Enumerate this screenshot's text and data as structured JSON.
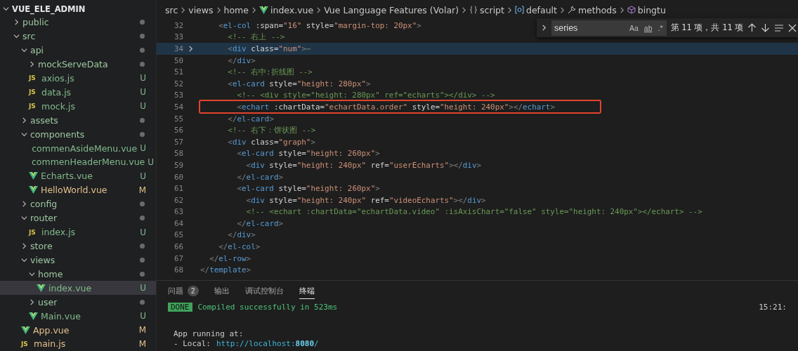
{
  "explorer": {
    "title": "VUE_ELE_ADMIN",
    "expanded": true,
    "items": [
      {
        "name": "public",
        "kind": "folder",
        "expanded": false,
        "dot": true,
        "selected": false
      },
      {
        "name": "src",
        "kind": "folder",
        "expanded": true,
        "dot": true,
        "selected": false,
        "children": [
          {
            "name": "api",
            "kind": "folder",
            "expanded": true,
            "dot": true,
            "selected": false,
            "children": [
              {
                "name": "mockServeData",
                "kind": "folder",
                "expanded": false,
                "dot": true,
                "selected": false
              },
              {
                "name": "axios.js",
                "kind": "js",
                "icon_label": "JS",
                "status": "U",
                "selected": false
              },
              {
                "name": "data.js",
                "kind": "js",
                "icon_label": "JS",
                "status": "U",
                "selected": false
              },
              {
                "name": "mock.js",
                "kind": "js",
                "icon_label": "JS",
                "status": "U",
                "selected": false
              }
            ]
          },
          {
            "name": "assets",
            "kind": "folder",
            "expanded": false,
            "dot": true,
            "selected": false
          },
          {
            "name": "components",
            "kind": "folder",
            "expanded": true,
            "dot": true,
            "selected": false,
            "children": [
              {
                "name": "commenAsideMenu.vue",
                "kind": "vue",
                "status": "U",
                "selected": false
              },
              {
                "name": "commenHeaderMenu.vue",
                "kind": "vue",
                "status": "U",
                "selected": false
              },
              {
                "name": "Echarts.vue",
                "kind": "vue",
                "status": "U",
                "selected": false
              },
              {
                "name": "HelloWorld.vue",
                "kind": "vue",
                "status": "M",
                "selected": false
              }
            ]
          },
          {
            "name": "config",
            "kind": "folder",
            "expanded": false,
            "dot": true,
            "selected": false
          },
          {
            "name": "router",
            "kind": "folder",
            "expanded": true,
            "dot": true,
            "selected": false,
            "children": [
              {
                "name": "index.js",
                "kind": "js",
                "icon_label": "JS",
                "status": "U",
                "selected": false
              }
            ]
          },
          {
            "name": "store",
            "kind": "folder",
            "expanded": false,
            "dot": true,
            "selected": false
          },
          {
            "name": "views",
            "kind": "folder",
            "expanded": true,
            "dot": true,
            "selected": false,
            "children": [
              {
                "name": "home",
                "kind": "folder",
                "expanded": true,
                "dot": true,
                "selected": false,
                "children": [
                  {
                    "name": "index.vue",
                    "kind": "vue",
                    "status": "U",
                    "selected": true
                  }
                ]
              },
              {
                "name": "user",
                "kind": "folder",
                "expanded": false,
                "dot": true,
                "selected": false
              },
              {
                "name": "Main.vue",
                "kind": "vue",
                "status": "U",
                "selected": false
              }
            ]
          },
          {
            "name": "App.vue",
            "kind": "vue",
            "status": "M",
            "selected": false
          },
          {
            "name": "main.js",
            "kind": "js",
            "icon_label": "JS",
            "status": "M",
            "selected": false
          }
        ]
      }
    ]
  },
  "breadcrumbs": [
    {
      "label": "src",
      "kind": "path"
    },
    {
      "label": "views",
      "kind": "path"
    },
    {
      "label": "home",
      "kind": "path"
    },
    {
      "label": "index.vue",
      "kind": "file"
    },
    {
      "label": "Vue Language Features (Volar)",
      "kind": "extension"
    },
    {
      "label": "script",
      "kind": "section"
    },
    {
      "label": "default",
      "kind": "variable"
    },
    {
      "label": "methods",
      "kind": "method"
    },
    {
      "label": "bingtu",
      "kind": "function"
    }
  ],
  "find": {
    "value": "series",
    "options": [
      "Aa",
      "ab",
      ".*"
    ],
    "result": "第 11 项，共 11 项"
  },
  "code": [
    {
      "number": "32",
      "current": false,
      "boxed": false,
      "folded": false,
      "text": "    <el-col :span=\"16\" style=\"margin-top: 20px\">"
    },
    {
      "number": "33",
      "current": false,
      "boxed": false,
      "folded": false,
      "text": "      <!-- 右上 -->"
    },
    {
      "number": "34",
      "current": true,
      "boxed": false,
      "folded": true,
      "text": "      <div class=\"num\">⋯"
    },
    {
      "number": "50",
      "current": false,
      "boxed": false,
      "folded": false,
      "text": "      </div>"
    },
    {
      "number": "51",
      "current": false,
      "boxed": false,
      "folded": false,
      "text": "      <!-- 右中:折线图 -->"
    },
    {
      "number": "52",
      "current": false,
      "boxed": false,
      "folded": false,
      "text": "      <el-card style=\"height: 280px\">"
    },
    {
      "number": "53",
      "current": false,
      "boxed": false,
      "folded": false,
      "text": "        <!-- <div style=\"height: 280px\" ref=\"echarts\"></div> -->"
    },
    {
      "number": "54",
      "current": false,
      "boxed": true,
      "folded": false,
      "text": "        <echart :chartData=\"echartData.order\" style=\"height: 240px\"></echart>"
    },
    {
      "number": "55",
      "current": false,
      "boxed": false,
      "folded": false,
      "text": "      </el-card>"
    },
    {
      "number": "56",
      "current": false,
      "boxed": false,
      "folded": false,
      "text": "      <!-- 右下：饼状图 -->"
    },
    {
      "number": "57",
      "current": false,
      "boxed": false,
      "folded": false,
      "text": "      <div class=\"graph\">"
    },
    {
      "number": "58",
      "current": false,
      "boxed": false,
      "folded": false,
      "text": "        <el-card style=\"height: 260px\">"
    },
    {
      "number": "59",
      "current": false,
      "boxed": false,
      "folded": false,
      "text": "          <div style=\"height: 240px\" ref=\"userEcharts\"></div>"
    },
    {
      "number": "60",
      "current": false,
      "boxed": false,
      "folded": false,
      "text": "        </el-card>"
    },
    {
      "number": "61",
      "current": false,
      "boxed": false,
      "folded": false,
      "text": "        <el-card style=\"height: 260px\">"
    },
    {
      "number": "62",
      "current": false,
      "boxed": false,
      "folded": false,
      "text": "          <div style=\"height: 240px\" ref=\"videoEcharts\"></div>"
    },
    {
      "number": "63",
      "current": false,
      "boxed": false,
      "folded": false,
      "text": "          <!-- <echart :chartData=\"echartData.video\" :isAxisChart=\"false\" style=\"height: 240px\"></echart> -->"
    },
    {
      "number": "64",
      "current": false,
      "boxed": false,
      "folded": false,
      "text": "        </el-card>"
    },
    {
      "number": "65",
      "current": false,
      "boxed": false,
      "folded": false,
      "text": "      </div>"
    },
    {
      "number": "66",
      "current": false,
      "boxed": false,
      "folded": false,
      "text": "    </el-col>"
    },
    {
      "number": "67",
      "current": false,
      "boxed": false,
      "folded": false,
      "text": "  </el-row>"
    },
    {
      "number": "68",
      "current": false,
      "boxed": false,
      "folded": false,
      "text": "</template>"
    }
  ],
  "panel": {
    "tabs": [
      {
        "label": "问题",
        "badge": "2",
        "selected": false
      },
      {
        "label": "输出",
        "selected": false
      },
      {
        "label": "调试控制台",
        "selected": false
      },
      {
        "label": "终端",
        "selected": true
      }
    ],
    "terminal": [
      {
        "kind": "status",
        "badge": "DONE",
        "text": "Compiled successfully in 523ms",
        "time": "15:21:"
      },
      {
        "kind": "plain",
        "text": "App running at:"
      },
      {
        "kind": "link",
        "text": "- Local:",
        "link": "http://localhost:**8080**/"
      }
    ]
  }
}
